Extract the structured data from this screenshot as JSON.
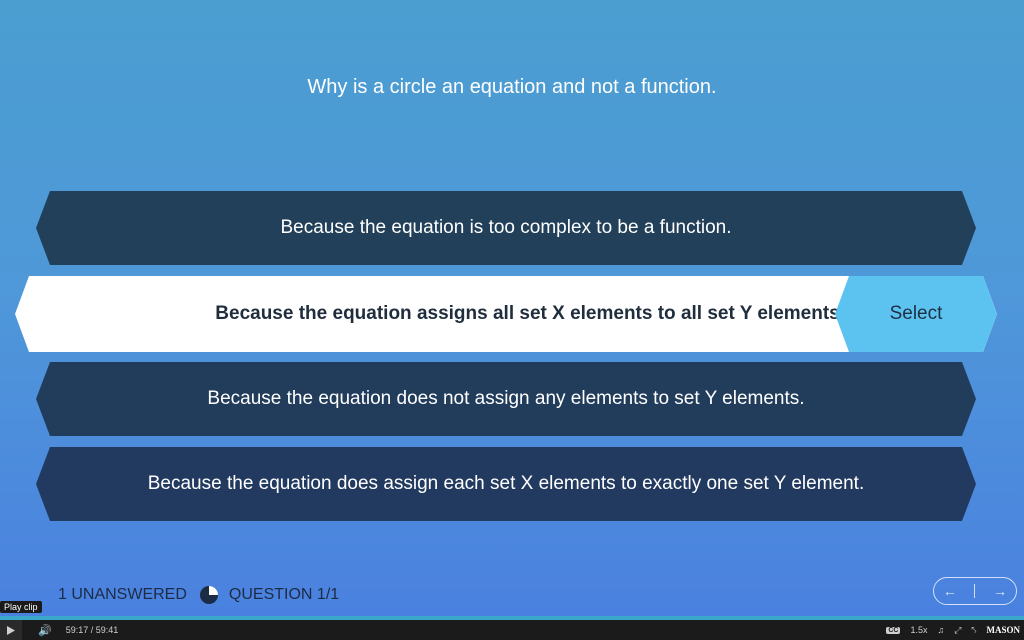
{
  "question": "Why is a circle an equation and not a function.",
  "options": [
    {
      "label": "Because the equation is too complex to be a function."
    },
    {
      "label": "Because the equation assigns all set X elements to all set Y elements.",
      "selected": true
    },
    {
      "label": "Because the equation does not assign any elements to set Y elements."
    },
    {
      "label": "Because the equation does assign each set X elements to exactly one set Y element."
    }
  ],
  "select_label": "Select",
  "status": {
    "unanswered": "1 UNANSWERED",
    "question_counter": "QUESTION 1/1",
    "progress_fraction": 0.25
  },
  "nav": {
    "prev_icon": "arrow-left-icon",
    "next_icon": "arrow-right-icon"
  },
  "player": {
    "tooltip": "Play clip",
    "current_time": "59:17",
    "total_time": "59:41",
    "speed": "1.5x",
    "cc_label": "CC",
    "logo": "MASON"
  },
  "colors": {
    "selected_bg": "#ffffff",
    "select_btn": "#5cc3f0",
    "option_bg": "#22405a"
  }
}
